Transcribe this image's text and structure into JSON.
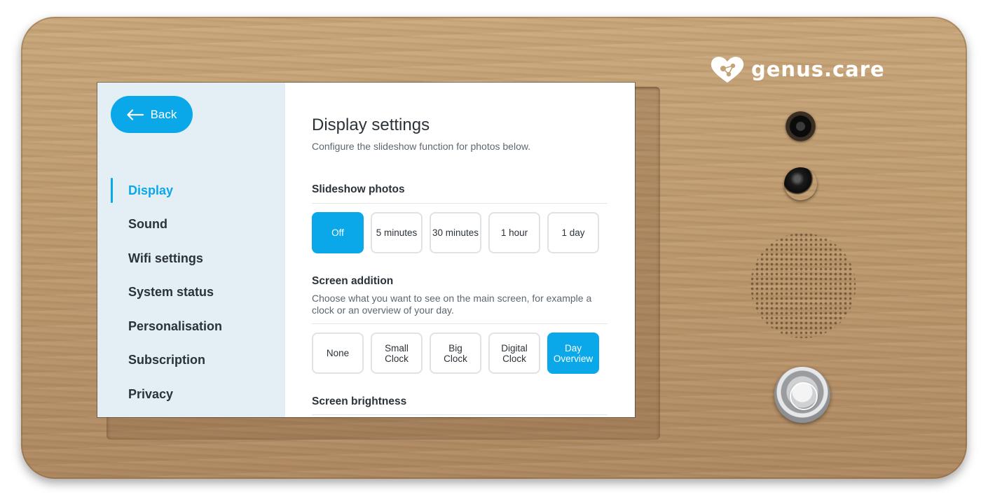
{
  "brand": {
    "logo_text": "genus.care"
  },
  "sidebar": {
    "back_label": "Back",
    "items": [
      {
        "label": "Display",
        "active": true
      },
      {
        "label": "Sound",
        "active": false
      },
      {
        "label": "Wifi settings",
        "active": false
      },
      {
        "label": "System status",
        "active": false
      },
      {
        "label": "Personalisation",
        "active": false
      },
      {
        "label": "Subscription",
        "active": false
      },
      {
        "label": "Privacy",
        "active": false
      }
    ]
  },
  "main": {
    "title": "Display settings",
    "subtitle": "Configure the slideshow function for photos below.",
    "slideshow": {
      "title": "Slideshow photos",
      "options": [
        "Off",
        "5 minutes",
        "30 minutes",
        "1 hour",
        "1 day"
      ],
      "selected": "Off"
    },
    "screen_addition": {
      "title": "Screen addition",
      "description": "Choose what you want to see on the main screen, for example a clock or an overview of your day.",
      "options": [
        "None",
        "Small\nClock",
        "Big\nClock",
        "Digital\nClock",
        "Day\nOverview"
      ],
      "selected": "Day\nOverview"
    },
    "brightness": {
      "title": "Screen brightness"
    }
  },
  "colors": {
    "accent": "#0aa8e8",
    "sidebar_bg": "#e4eef5",
    "text": "#2b3238"
  }
}
